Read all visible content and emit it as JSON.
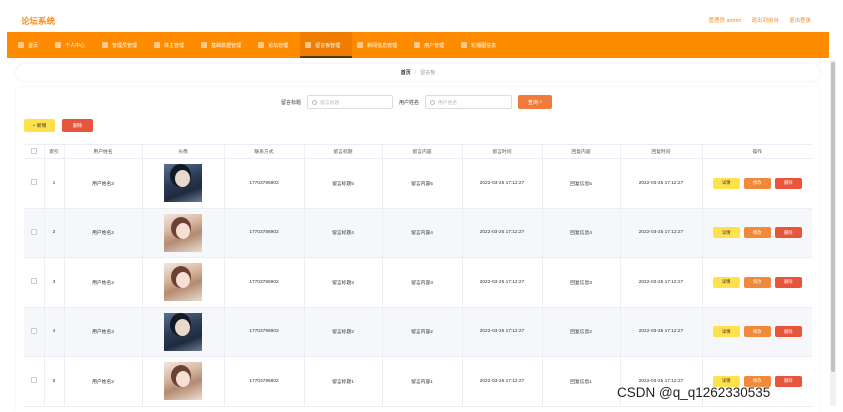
{
  "app": {
    "title": "论坛系统"
  },
  "header": {
    "links": [
      "管理员 admin",
      "退出到前台",
      "退出登录"
    ]
  },
  "nav": {
    "items": [
      {
        "label": "首页",
        "icon": "home-icon"
      },
      {
        "label": "个人中心",
        "icon": "user-icon"
      },
      {
        "label": "管理员管理",
        "icon": "admin-icon"
      },
      {
        "label": "体主管理",
        "icon": "people-icon"
      },
      {
        "label": "基础数据管理",
        "icon": "data-icon"
      },
      {
        "label": "论坛管理",
        "icon": "forum-icon"
      },
      {
        "label": "留言板管理",
        "icon": "message-icon",
        "active": true
      },
      {
        "label": "新闻信息管理",
        "icon": "news-icon"
      },
      {
        "label": "用户管理",
        "icon": "users-icon"
      },
      {
        "label": "轮播图信息",
        "icon": "carousel-icon"
      }
    ]
  },
  "breadcrumb": {
    "home": "首页",
    "separator": "/",
    "current": "留言板"
  },
  "search": {
    "title_label": "留言标题",
    "title_placeholder": "留言标题",
    "user_label": "用户姓名",
    "user_placeholder": "用户姓名",
    "button": "查询"
  },
  "actions": {
    "add": "+ 新增",
    "delete": "删除"
  },
  "table": {
    "headers": [
      "索引",
      "用户姓名",
      "头像",
      "联系方式",
      "留言标题",
      "留言内容",
      "留言时间",
      "回复内容",
      "回复时间",
      "操作"
    ],
    "rows": [
      {
        "index": "1",
        "user": "用户姓名3",
        "avatar": "dark",
        "phone": "17703786903",
        "title": "留言标题5",
        "content": "留言内容5",
        "time": "2022-03-25 17:12:27",
        "reply": "回复信息5",
        "reply_time": "2022-03-25 17:12:27"
      },
      {
        "index": "2",
        "user": "用户姓名2",
        "avatar": "light",
        "phone": "17703786902",
        "title": "留言标题4",
        "content": "留言内容4",
        "time": "2022-03-25 17:12:27",
        "reply": "回复信息4",
        "reply_time": "2022-03-25 17:12:27"
      },
      {
        "index": "3",
        "user": "用户姓名2",
        "avatar": "light",
        "phone": "17703786902",
        "title": "留言标题3",
        "content": "留言内容3",
        "time": "2022-03-25 17:12:27",
        "reply": "回复信息3",
        "reply_time": "2022-03-25 17:12:27"
      },
      {
        "index": "4",
        "user": "用户姓名3",
        "avatar": "dark",
        "phone": "17703786903",
        "title": "留言标题2",
        "content": "留言内容2",
        "time": "2022-03-25 17:12:27",
        "reply": "回复信息2",
        "reply_time": "2022-03-25 17:12:27"
      },
      {
        "index": "5",
        "user": "用户姓名2",
        "avatar": "light",
        "phone": "17703786902",
        "title": "留言标题1",
        "content": "留言内容1",
        "time": "2022-03-25 17:12:27",
        "reply": "回复信息1",
        "reply_time": "2022-03-25 17:12:27"
      }
    ],
    "row_actions": {
      "detail": "详情",
      "edit": "修改",
      "delete": "删除"
    }
  },
  "watermark": "CSDN @q_q1262330535",
  "colors": {
    "brand": "#ff8c00",
    "accent_yellow": "#ffe14d",
    "danger": "#e8553d",
    "edit": "#f08a3a"
  }
}
